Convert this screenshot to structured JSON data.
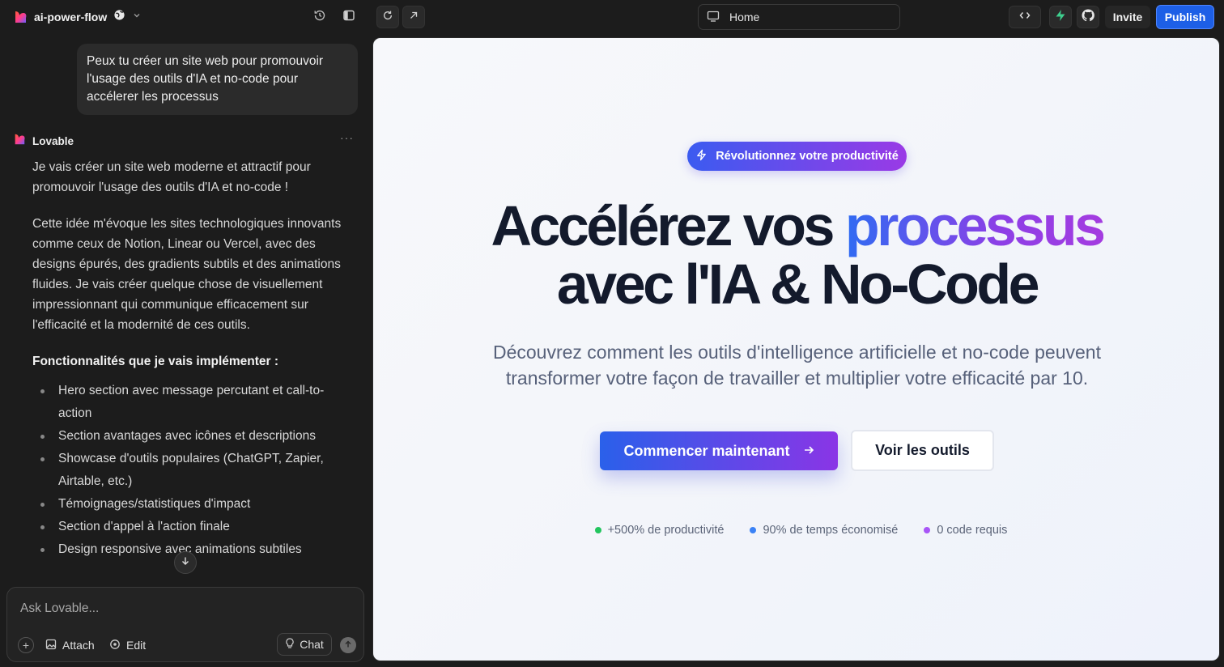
{
  "topbar": {
    "project_name": "ai-power-flow",
    "url_page": "Home",
    "invite_label": "Invite",
    "publish_label": "Publish"
  },
  "chat": {
    "user_message": "Peux tu créer un site web pour promouvoir l'usage des outils d'IA et no-code pour accélerer les processus",
    "assistant_name": "Lovable",
    "paragraphs": [
      "Je vais créer un site web moderne et attractif pour promouvoir l'usage des outils d'IA et no-code !",
      "Cette idée m'évoque les sites technologiques innovants comme ceux de Notion, Linear ou Vercel, avec des designs épurés, des gradients subtils et des animations fluides. Je vais créer quelque chose de visuellement impressionnant qui communique efficacement sur l'efficacité et la modernité de ces outils."
    ],
    "features_heading": "Fonctionnalités que je vais implémenter :",
    "features": [
      "Hero section avec message percutant et call-to-action",
      "Section avantages avec icônes et descriptions",
      "Showcase d'outils populaires (ChatGPT, Zapier, Airtable, etc.)",
      "Témoignages/statistiques d'impact",
      "Section d'appel à l'action finale",
      "Design responsive avec animations subtiles"
    ],
    "composer": {
      "placeholder": "Ask Lovable...",
      "attach_label": "Attach",
      "edit_label": "Edit",
      "chat_label": "Chat"
    }
  },
  "preview": {
    "badge": "Révolutionnez votre productivité",
    "title_part1": "Accélérez vos ",
    "title_highlight": "processus",
    "title_line2": "avec l'IA & No-Code",
    "subtitle": "Découvrez comment les outils d'intelligence artificielle et no-code peuvent transformer votre façon de travailler et multiplier votre efficacité par 10.",
    "primary_cta": "Commencer maintenant",
    "secondary_cta": "Voir les outils",
    "stats": [
      {
        "label": "+500% de productivité",
        "color": "#22c55e"
      },
      {
        "label": "90% de temps économisé",
        "color": "#3b82f6"
      },
      {
        "label": "0 code requis",
        "color": "#a855f7"
      }
    ]
  },
  "colors": {
    "accent_blue": "#1d5fe6",
    "gradient_start": "#2f6bf2",
    "gradient_end": "#9a3ae6",
    "supabase_green": "#3ecf8e"
  }
}
